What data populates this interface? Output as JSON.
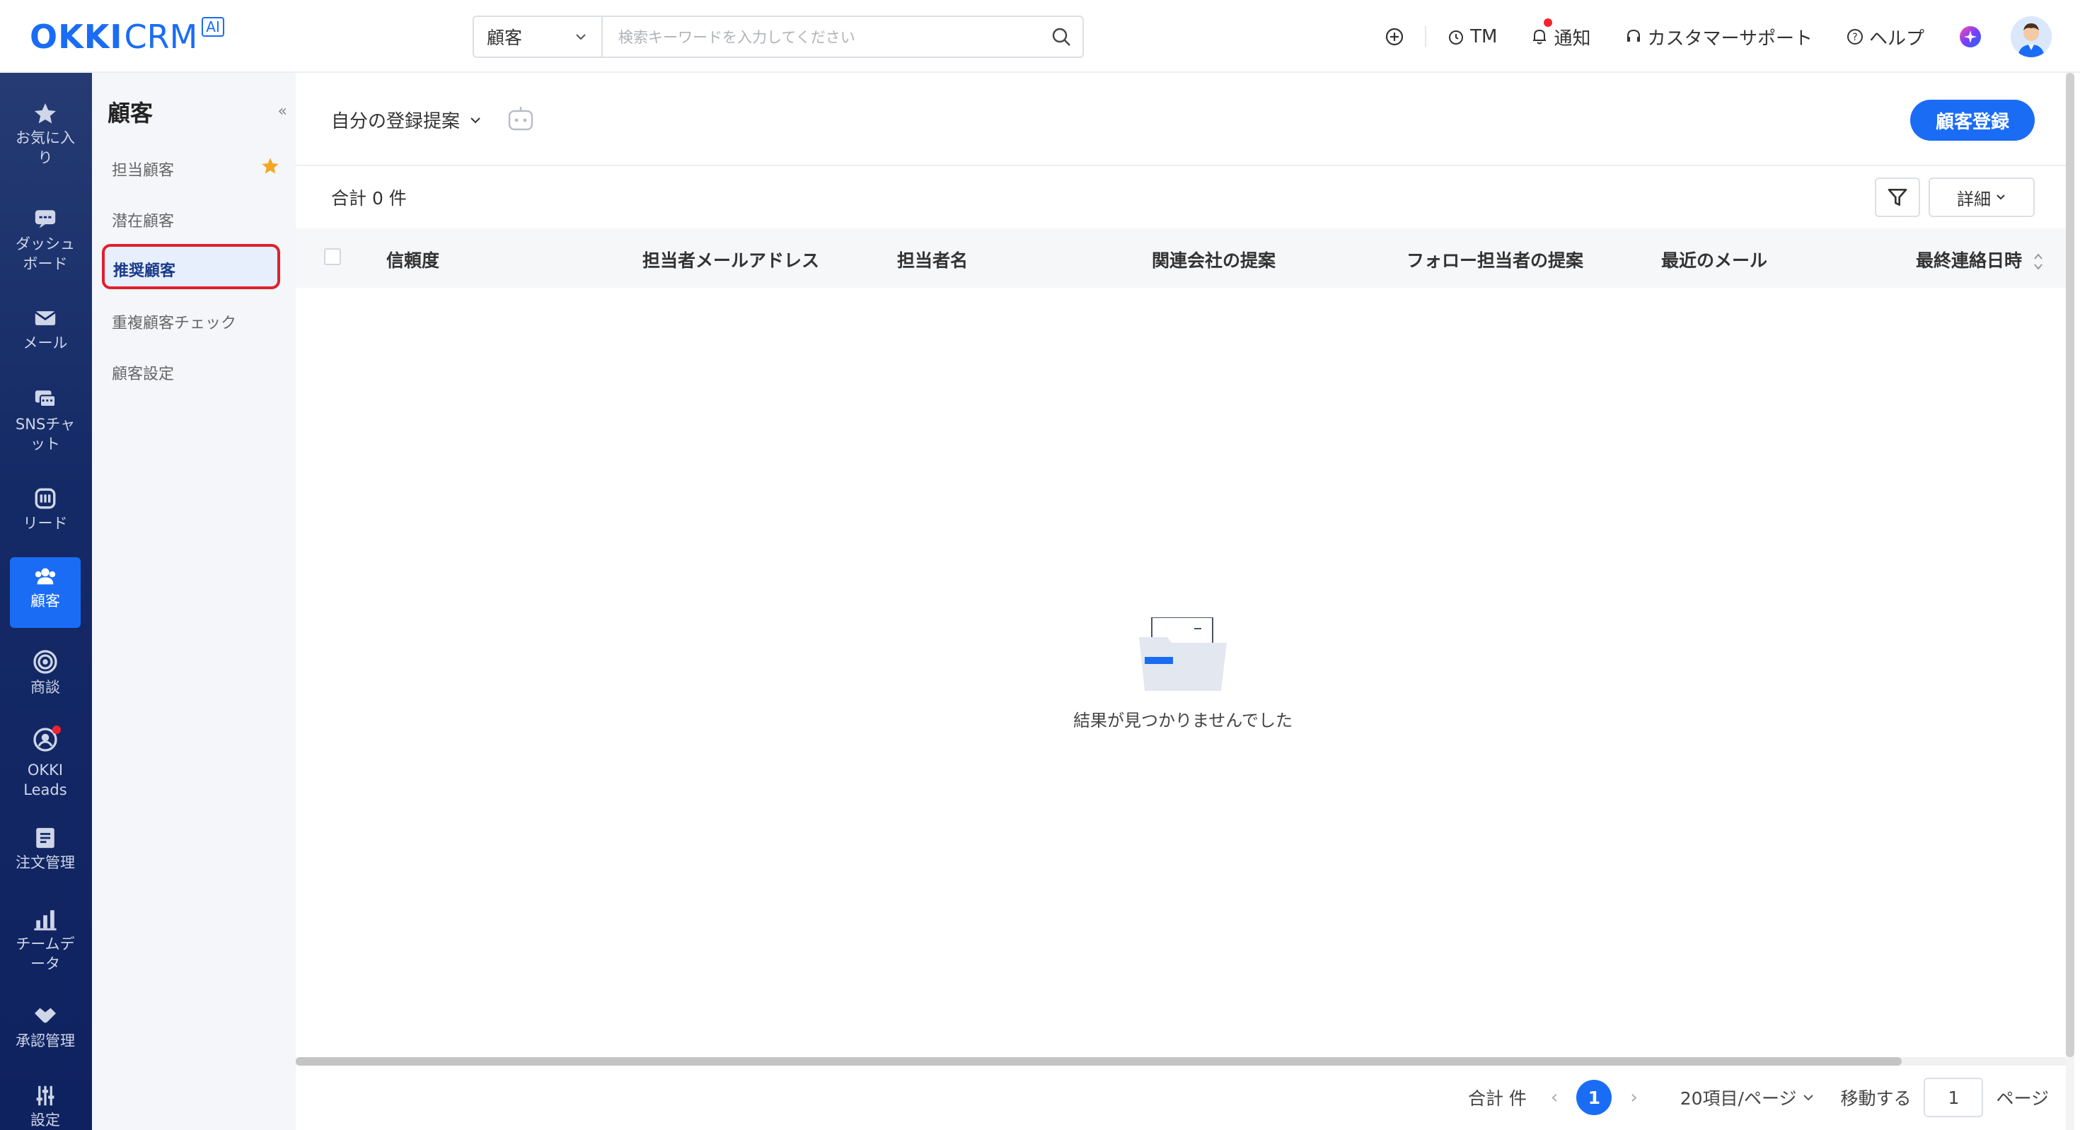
{
  "brand": {
    "name_bold": "OKKI",
    "name_light": "CRM",
    "badge": "AI"
  },
  "search": {
    "type_value": "顧客",
    "placeholder": "検索キーワードを入力してください"
  },
  "topnav": {
    "tm": "TM",
    "notify": "通知",
    "support": "カスタマーサポート",
    "help": "ヘルプ"
  },
  "leftnav": {
    "items": [
      {
        "label": "お気に入り",
        "icon": "star-icon"
      },
      {
        "label": "ダッシュボード",
        "icon": "dashboard-icon"
      },
      {
        "label": "メール",
        "icon": "mail-icon"
      },
      {
        "label": "SNSチャット",
        "icon": "chat-icon"
      },
      {
        "label": "リード",
        "icon": "lead-icon"
      },
      {
        "label": "顧客",
        "icon": "customers-icon"
      },
      {
        "label": "商談",
        "icon": "target-icon"
      },
      {
        "label": "OKKI Leads",
        "icon": "okki-leads-icon"
      },
      {
        "label": "注文管理",
        "icon": "order-icon"
      },
      {
        "label": "チームデータ",
        "icon": "chart-icon"
      },
      {
        "label": "承認管理",
        "icon": "handshake-icon"
      },
      {
        "label": "設定",
        "icon": "settings-icon"
      }
    ]
  },
  "subnav": {
    "title": "顧客",
    "items": [
      "担当顧客",
      "潜在顧客",
      "推奨顧客",
      "重複顧客チェック",
      "顧客設定"
    ]
  },
  "main": {
    "view_label": "自分の登録提案",
    "create_button": "顧客登録",
    "total": "合計 0 件",
    "detail_button": "詳細",
    "columns": [
      "信頼度",
      "担当者メールアドレス",
      "担当者名",
      "関連会社の提案",
      "フォロー担当者の提案",
      "最近のメール",
      "最終連絡日時"
    ],
    "empty_message": "結果が見つかりませんでした"
  },
  "pager": {
    "total": "合計 件",
    "page": "1",
    "per_page": "20項目/ページ",
    "goto": "移動する",
    "goto_value": "1",
    "page_suffix": "ページ"
  },
  "colors": {
    "primary": "#1a6cf5",
    "nav_bg": "#142a66",
    "highlight_border": "#e0202e"
  }
}
